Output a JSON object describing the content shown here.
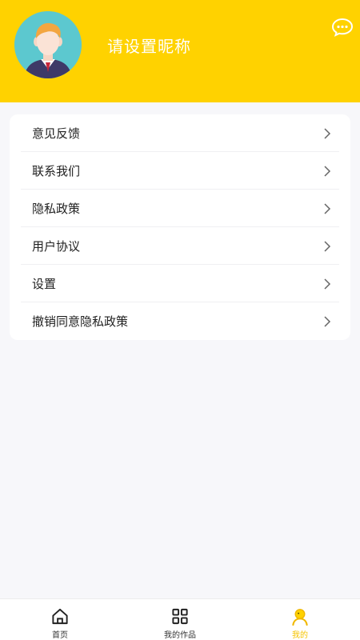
{
  "header": {
    "nickname": "请设置昵称",
    "avatar_icon": "avatar-icon",
    "message_icon": "message-icon",
    "background": "#ffd200"
  },
  "menu": {
    "items": [
      {
        "label": "意见反馈"
      },
      {
        "label": "联系我们"
      },
      {
        "label": "隐私政策"
      },
      {
        "label": "用户协议"
      },
      {
        "label": "设置"
      },
      {
        "label": "撤销同意隐私政策"
      }
    ]
  },
  "tabbar": {
    "tabs": [
      {
        "label": "首页",
        "icon": "home-icon",
        "active": false
      },
      {
        "label": "我的作品",
        "icon": "grid-icon",
        "active": false
      },
      {
        "label": "我的",
        "icon": "profile-icon",
        "active": true
      }
    ],
    "active_color": "#f5c400"
  }
}
